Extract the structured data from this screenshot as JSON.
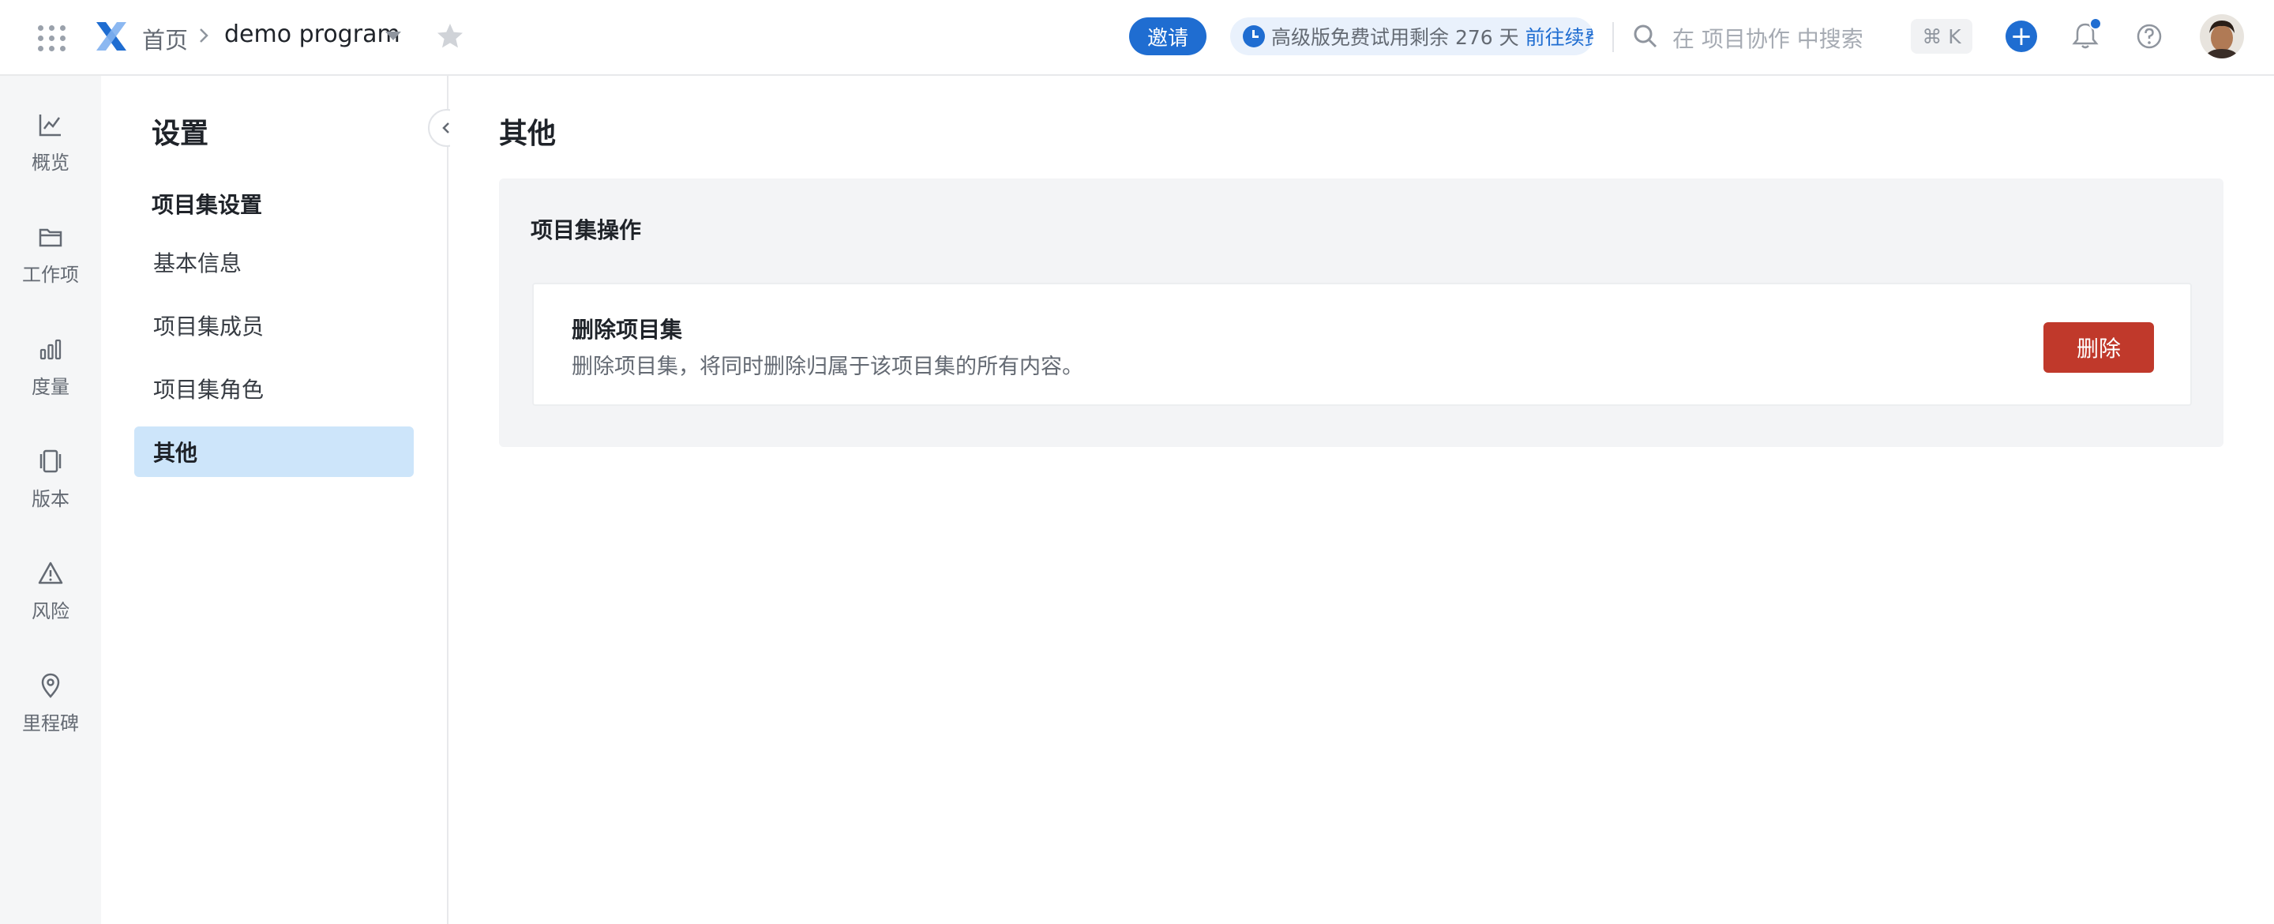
{
  "header": {
    "breadcrumb_home": "首页",
    "program_name": "demo program",
    "invite_label": "邀请",
    "trial_text": "高级版免费试用剩余 276 天",
    "trial_link": "前往续费",
    "search_placeholder": "在 项目协作 中搜索",
    "shortcut": "⌘ K",
    "colors": {
      "accent": "#1f6dd1"
    }
  },
  "rail": {
    "items": [
      {
        "label": "概览",
        "icon": "chart-line-icon"
      },
      {
        "label": "工作项",
        "icon": "folder-icon"
      },
      {
        "label": "度量",
        "icon": "bar-chart-icon"
      },
      {
        "label": "版本",
        "icon": "version-icon"
      },
      {
        "label": "风险",
        "icon": "warning-icon"
      },
      {
        "label": "里程碑",
        "icon": "location-pin-icon"
      }
    ]
  },
  "settings_nav": {
    "title": "设置",
    "group_title": "项目集设置",
    "items": [
      {
        "label": "基本信息"
      },
      {
        "label": "项目集成员"
      },
      {
        "label": "项目集角色"
      },
      {
        "label": "其他",
        "active": true
      }
    ]
  },
  "main": {
    "title": "其他",
    "section_title": "项目集操作",
    "card": {
      "title": "删除项目集",
      "description": "删除项目集，将同时删除归属于该项目集的所有内容。",
      "button_label": "删除",
      "button_color": "#c0392b"
    }
  }
}
